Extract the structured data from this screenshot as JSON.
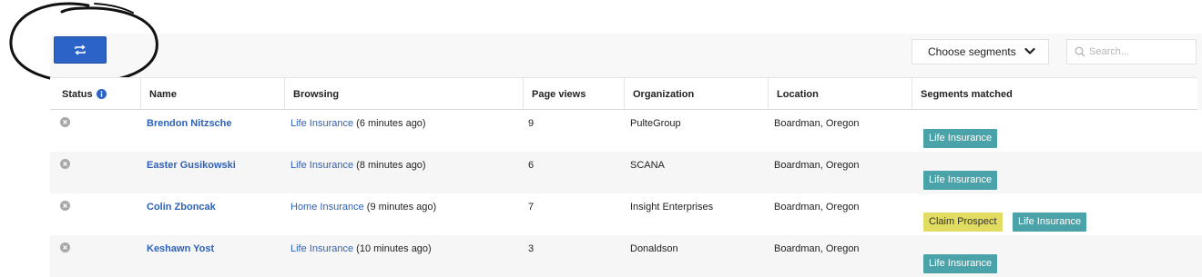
{
  "toolbar": {
    "refresh_icon": "refresh-icon",
    "segments_select": "Choose segments",
    "search_placeholder": "Search..."
  },
  "table": {
    "columns": [
      "Status",
      "Name",
      "Browsing",
      "Page views",
      "Organization",
      "Location",
      "Segments matched"
    ],
    "rows": [
      {
        "name": "Brendon Nitzsche",
        "browsing_link": "Life Insurance",
        "browsing_time": " (6 minutes ago)",
        "page_views": "9",
        "organization": "PulteGroup",
        "location": "Boardman, Oregon",
        "segments": [
          "Life Insurance"
        ]
      },
      {
        "name": "Easter Gusikowski",
        "browsing_link": "Life Insurance",
        "browsing_time": " (8 minutes ago)",
        "page_views": "6",
        "organization": "SCANA",
        "location": "Boardman, Oregon",
        "segments": [
          "Life Insurance"
        ]
      },
      {
        "name": "Colin Zboncak",
        "browsing_link": "Home Insurance",
        "browsing_time": " (9 minutes ago)",
        "page_views": "7",
        "organization": "Insight Enterprises",
        "location": "Boardman, Oregon",
        "segments": [
          "Claim Prospect",
          "Life Insurance"
        ]
      },
      {
        "name": "Keshawn Yost",
        "browsing_link": "Life Insurance",
        "browsing_time": " (10 minutes ago)",
        "page_views": "3",
        "organization": "Donaldson",
        "location": "Boardman, Oregon",
        "segments": [
          "Life Insurance"
        ]
      }
    ]
  },
  "colors": {
    "primary": "#2b64c6",
    "link": "#2e62b9",
    "segment_life_insurance": "#4aa3a8",
    "segment_claim_prospect": "#e2dc63",
    "status_inactive": "#a8a8a8"
  }
}
